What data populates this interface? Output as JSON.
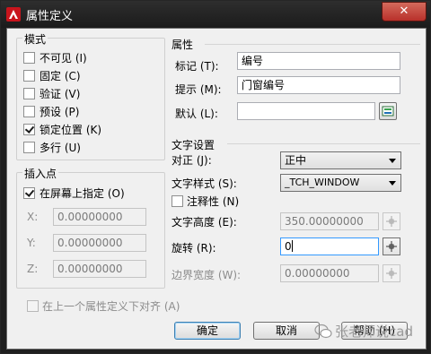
{
  "window": {
    "title": "属性定义",
    "close_glyph": "✕"
  },
  "mode": {
    "title": "模式",
    "items": [
      {
        "label": "不可见 (I)",
        "checked": false
      },
      {
        "label": "固定 (C)",
        "checked": false
      },
      {
        "label": "验证 (V)",
        "checked": false
      },
      {
        "label": "预设 (P)",
        "checked": false
      },
      {
        "label": "锁定位置 (K)",
        "checked": true
      },
      {
        "label": "多行 (U)",
        "checked": false
      }
    ]
  },
  "insertion": {
    "title": "插入点",
    "on_screen_label": "在屏幕上指定 (O)",
    "on_screen_checked": true,
    "x_label": "X:",
    "x_value": "0.00000000",
    "y_label": "Y:",
    "y_value": "0.00000000",
    "z_label": "Z:",
    "z_value": "0.00000000"
  },
  "attribute": {
    "title": "属性",
    "tag_label": "标记 (T):",
    "tag_value": "编号",
    "prompt_label": "提示 (M):",
    "prompt_value": "门窗编号",
    "default_label": "默认 (L):",
    "default_value": ""
  },
  "text_settings": {
    "title": "文字设置",
    "justify_label": "对正 (J):",
    "justify_value": "正中",
    "style_label": "文字样式 (S):",
    "style_value": "_TCH_WINDOW",
    "annotative_label": "注释性 (N)",
    "annotative_checked": false,
    "height_label": "文字高度 (E):",
    "height_value": "350.00000000",
    "rotation_label": "旋转 (R):",
    "rotation_value": "0",
    "width_label": "边界宽度 (W):",
    "width_value": "0.00000000"
  },
  "align_below": {
    "label": "在上一个属性定义下对齐 (A)",
    "checked": false
  },
  "buttons": {
    "ok": "确定",
    "cancel": "取消",
    "help": "帮助 (H)"
  },
  "watermark": "张老师说cad",
  "colors": {
    "accent": "#3399ff",
    "titlebar": "#1f1f1f",
    "close": "#c42b1c",
    "app_icon": "#c8141c"
  }
}
